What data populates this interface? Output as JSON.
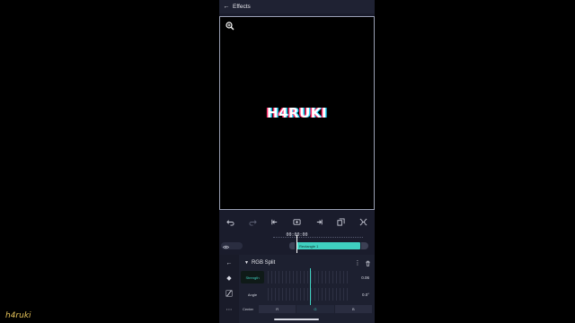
{
  "header": {
    "title": "Effects",
    "back_icon": "arrow-left-icon"
  },
  "preview": {
    "logo_text": "H4RUKI",
    "zoom_icon": "zoom-icon"
  },
  "toolbar": {
    "icons": [
      "undo-icon",
      "redo-icon",
      "jump-start-icon",
      "add-keyframe-icon",
      "jump-end-icon",
      "copy-icon",
      "fullscreen-icon"
    ]
  },
  "timeline": {
    "timecode": "00:00:00",
    "clip_label": "Rectangle 1"
  },
  "effect_panel": {
    "name": "RGB Split",
    "params": [
      {
        "label": "Strength",
        "value": "0.06"
      },
      {
        "label": "Angle",
        "value": "0.0°"
      }
    ],
    "center": {
      "label": "Center",
      "options": [
        "R",
        "G",
        "B"
      ],
      "selected": "G"
    }
  },
  "colors": {
    "accent": "#3fd0c0",
    "panel_bg": "#1d2030",
    "watermark": "#e6c35a"
  },
  "watermark": "h4ruki"
}
